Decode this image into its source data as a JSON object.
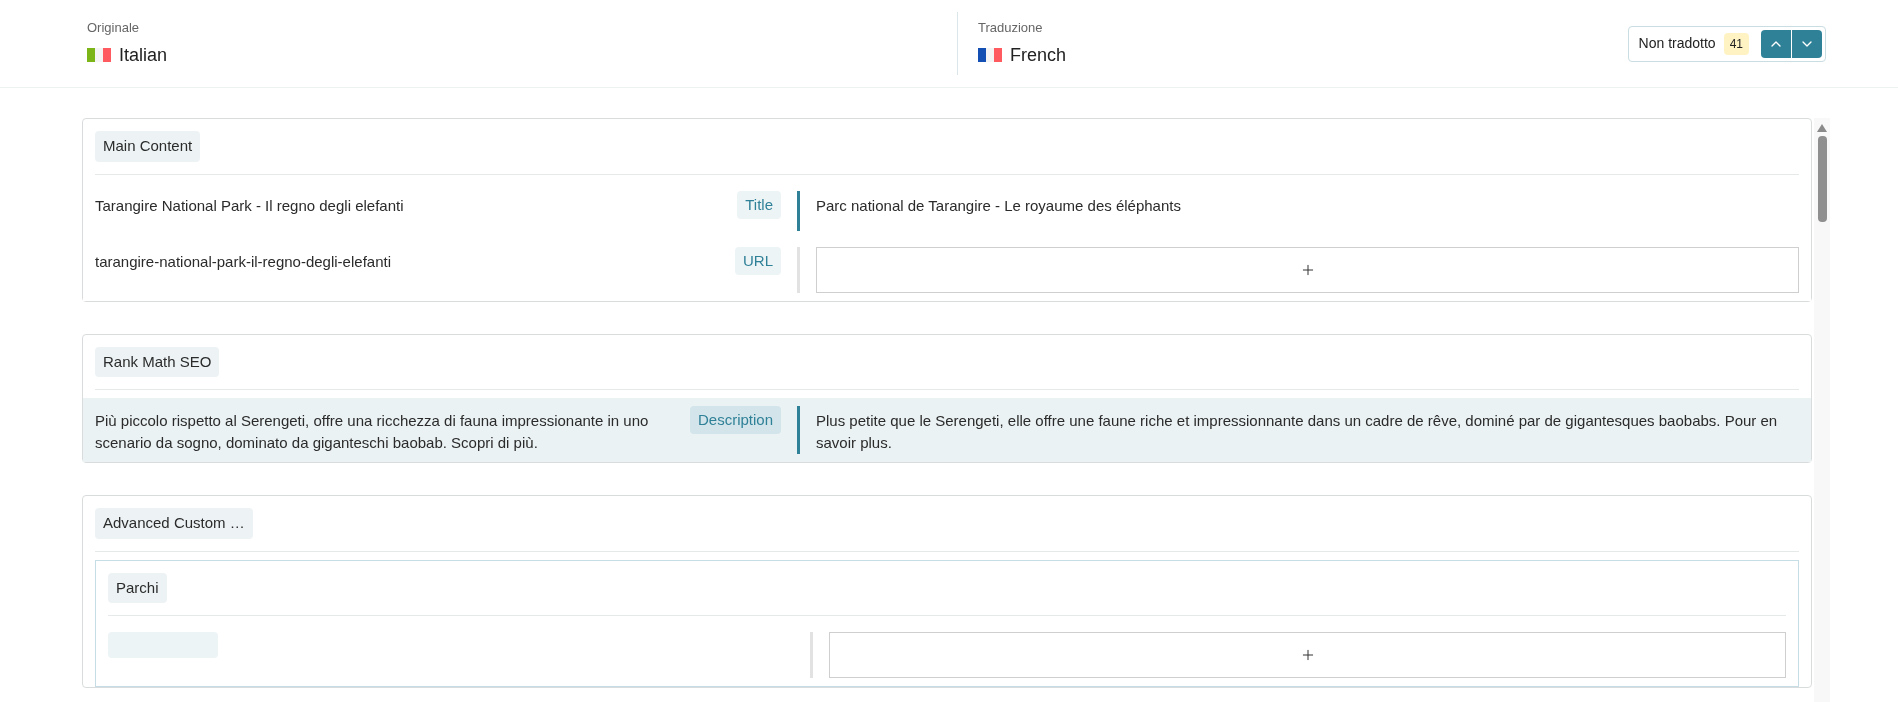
{
  "header": {
    "original": {
      "label": "Originale",
      "language": "Italian"
    },
    "translation": {
      "label": "Traduzione",
      "language": "French"
    },
    "filter": {
      "label": "Non tradotto",
      "count": "41"
    }
  },
  "sections": [
    {
      "title": "Main Content",
      "rows": [
        {
          "kind": "text",
          "original": "Tarangire National Park - Il regno degli elefanti",
          "field": "Title",
          "translated": true,
          "selected": false,
          "translation": "Parc national de Tarangire - Le royaume des éléphants"
        },
        {
          "kind": "empty",
          "original": "tarangire-national-park-il-regno-degli-elefanti",
          "field": "URL",
          "translated": false,
          "selected": false
        }
      ]
    },
    {
      "title": "Rank Math SEO",
      "rows": [
        {
          "kind": "text",
          "original": "Più piccolo rispetto al Serengeti, offre una ricchezza di fauna impressionante in uno scenario da sogno, dominato da giganteschi baobab. Scopri di più.",
          "field": "Description",
          "translated": true,
          "selected": true,
          "translation": "Plus petite que le Serengeti, elle offre une faune riche et impressionnante dans un cadre de rêve, dominé par de gigantesques baobabs. Pour en savoir plus."
        }
      ]
    },
    {
      "title": "Advanced Custom …",
      "groups": [
        {
          "title": "Parchi",
          "rows": [
            {
              "kind": "empty",
              "translated": false,
              "selected": false
            }
          ]
        }
      ]
    }
  ]
}
